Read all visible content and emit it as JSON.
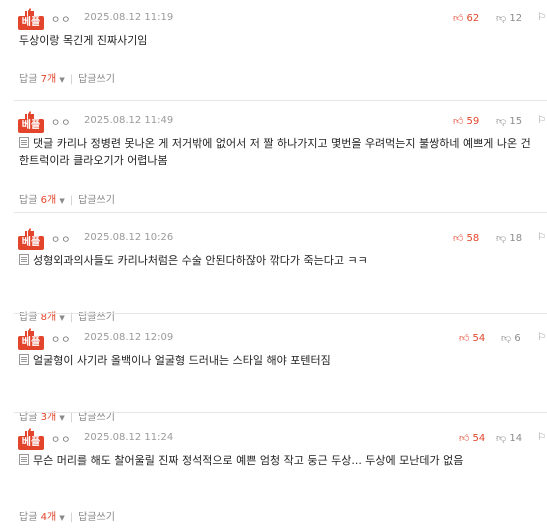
{
  "comments": [
    {
      "badge": "베플",
      "nick": "ㅇㅇ",
      "date": "2025.08.12 11:19",
      "likes": "62",
      "dislikes": "12",
      "has_doc_icon": false,
      "text": "두상이랑 목긴게 진짜사기임",
      "reply_label": "답글",
      "reply_count": "7개",
      "write_reply": "답글쓰기"
    },
    {
      "badge": "베플",
      "nick": "ㅇㅇ",
      "date": "2025.08.12 11:49",
      "likes": "59",
      "dislikes": "15",
      "has_doc_icon": true,
      "text": "댓글 카리나 정병련 못나온 게 저거밖에 없어서 저 짤 하나가지고 몇번을 우려먹는지 불쌍하네 예쁘게 나온 건 한트럭이라 클라오기가 어렵나봄",
      "reply_label": "답글",
      "reply_count": "6개",
      "write_reply": "답글쓰기"
    },
    {
      "badge": "베플",
      "nick": "ㅇㅇ",
      "date": "2025.08.12 10:26",
      "likes": "58",
      "dislikes": "18",
      "has_doc_icon": true,
      "text": "성형외과의사들도 카리나처럼은 수술 안된다하잖아 깎다가 죽는다고 ㅋㅋ",
      "reply_label": "답글",
      "reply_count": "8개",
      "write_reply": "답글쓰기"
    },
    {
      "badge": "베플",
      "nick": "ㅇㅇ",
      "date": "2025.08.12 12:09",
      "likes": "54",
      "dislikes": "6",
      "has_doc_icon": true,
      "text": "얼굴형이 사기라 올백이나 얼굴형 드러내는 스타일 해야 포텐터짐",
      "reply_label": "답글",
      "reply_count": "3개",
      "write_reply": "답글쓰기"
    },
    {
      "badge": "베플",
      "nick": "ㅇㅇ",
      "date": "2025.08.12 11:24",
      "likes": "54",
      "dislikes": "14",
      "has_doc_icon": true,
      "text": "무슨 머리를 해도 찰어울릴 진짜 정석적으로 예쁜 엄청 작고 둥근 두상... 두상에 모난데가 없음",
      "reply_label": "답글",
      "reply_count": "4개",
      "write_reply": "답글쓰기"
    }
  ],
  "colors": {
    "accent": "#e2452b",
    "muted": "#888888",
    "divider": "#e6e6e6"
  },
  "icons": {
    "best": "thumbs-up-icon",
    "like": "thumbs-up-icon",
    "dislike": "thumbs-down-icon",
    "doc": "document-icon",
    "caret": "caret-down-icon"
  }
}
